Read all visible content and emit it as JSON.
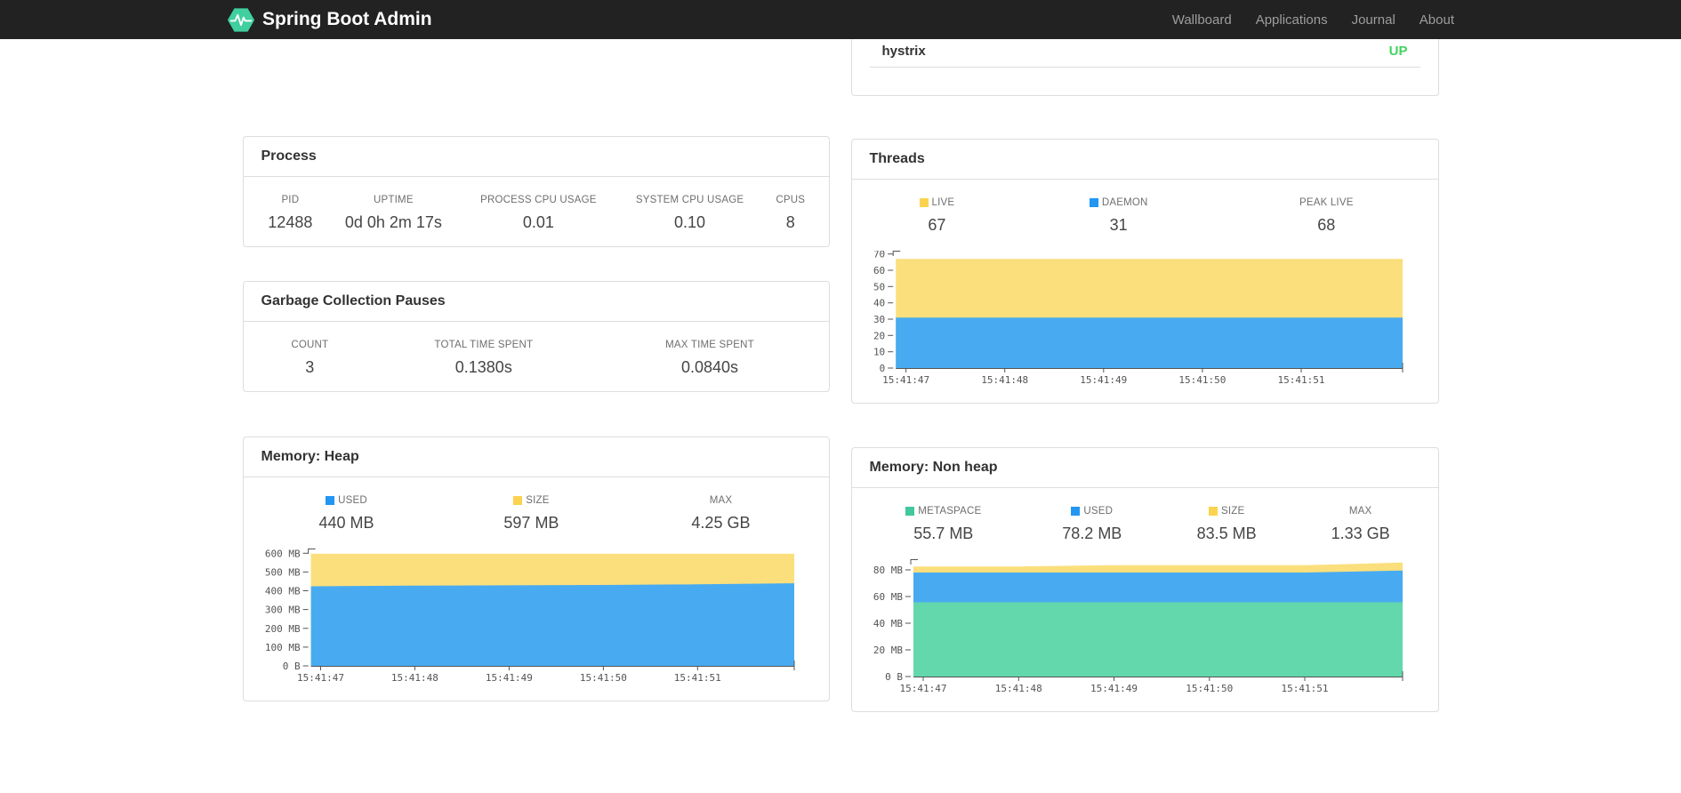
{
  "navbar": {
    "brand": "Spring Boot Admin",
    "links": [
      {
        "label": "Wallboard"
      },
      {
        "label": "Applications"
      },
      {
        "label": "Journal"
      },
      {
        "label": "About"
      }
    ]
  },
  "colors": {
    "brand_green": "#40cf9f",
    "status_up": "#42d35f",
    "area_yellow": "#fbdf7c",
    "area_blue": "#48abf1",
    "area_green": "#62d8ac",
    "swatch_yellow": "#fcd34f",
    "swatch_blue": "#2196f3",
    "swatch_green": "#43c79e"
  },
  "status_card": {
    "service_name": "hystrix",
    "status": "UP"
  },
  "cards": {
    "process": {
      "title": "Process",
      "stats": [
        {
          "label": "PID",
          "value": "12488"
        },
        {
          "label": "UPTIME",
          "value": "0d 0h 2m 17s"
        },
        {
          "label": "PROCESS CPU USAGE",
          "value": "0.01"
        },
        {
          "label": "SYSTEM CPU USAGE",
          "value": "0.10"
        },
        {
          "label": "CPUS",
          "value": "8"
        }
      ]
    },
    "gc": {
      "title": "Garbage Collection Pauses",
      "stats": [
        {
          "label": "COUNT",
          "value": "3"
        },
        {
          "label": "TOTAL TIME SPENT",
          "value": "0.1380s"
        },
        {
          "label": "MAX TIME SPENT",
          "value": "0.0840s"
        }
      ]
    },
    "threads": {
      "title": "Threads",
      "stats": [
        {
          "label": "LIVE",
          "value": "67",
          "swatch": "#fcd34f"
        },
        {
          "label": "DAEMON",
          "value": "31",
          "swatch": "#2196f3"
        },
        {
          "label": "PEAK LIVE",
          "value": "68"
        }
      ]
    },
    "heap": {
      "title": "Memory: Heap",
      "stats": [
        {
          "label": "USED",
          "value": "440 MB",
          "swatch": "#2196f3"
        },
        {
          "label": "SIZE",
          "value": "597 MB",
          "swatch": "#fcd34f"
        },
        {
          "label": "MAX",
          "value": "4.25 GB"
        }
      ]
    },
    "nonheap": {
      "title": "Memory: Non heap",
      "stats": [
        {
          "label": "METASPACE",
          "value": "55.7 MB",
          "swatch": "#43c79e"
        },
        {
          "label": "USED",
          "value": "78.2 MB",
          "swatch": "#2196f3"
        },
        {
          "label": "SIZE",
          "value": "83.5 MB",
          "swatch": "#fcd34f"
        },
        {
          "label": "MAX",
          "value": "1.33 GB"
        }
      ]
    }
  },
  "chart_data": [
    {
      "id": "threads",
      "type": "area",
      "title": "Threads",
      "x": [
        "15:41:47",
        "15:41:48",
        "15:41:49",
        "15:41:50",
        "15:41:51"
      ],
      "ylim": [
        0,
        72
      ],
      "yticks": [
        {
          "v": 0,
          "label": "0"
        },
        {
          "v": 10,
          "label": "10"
        },
        {
          "v": 20,
          "label": "20"
        },
        {
          "v": 30,
          "label": "30"
        },
        {
          "v": 40,
          "label": "40"
        },
        {
          "v": 50,
          "label": "50"
        },
        {
          "v": 60,
          "label": "60"
        },
        {
          "v": 70,
          "label": "70"
        }
      ],
      "series": [
        {
          "name": "live",
          "color": "#fbdf7c",
          "values": [
            67,
            67,
            67,
            67,
            67,
            67
          ]
        },
        {
          "name": "daemon",
          "color": "#48abf1",
          "values": [
            31,
            31,
            31,
            31,
            31,
            31
          ]
        }
      ]
    },
    {
      "id": "heap",
      "type": "area",
      "title": "Memory: Heap",
      "x": [
        "15:41:47",
        "15:41:48",
        "15:41:49",
        "15:41:50",
        "15:41:51"
      ],
      "ylim": [
        0,
        625
      ],
      "yticks": [
        {
          "v": 0,
          "label": "0 B"
        },
        {
          "v": 100,
          "label": "100 MB"
        },
        {
          "v": 200,
          "label": "200 MB"
        },
        {
          "v": 300,
          "label": "300 MB"
        },
        {
          "v": 400,
          "label": "400 MB"
        },
        {
          "v": 500,
          "label": "500 MB"
        },
        {
          "v": 600,
          "label": "600 MB"
        }
      ],
      "series": [
        {
          "name": "size",
          "color": "#fbdf7c",
          "values": [
            597,
            597,
            597,
            597,
            597,
            597
          ]
        },
        {
          "name": "used",
          "color": "#48abf1",
          "values": [
            424,
            427,
            429,
            431,
            434,
            440
          ]
        }
      ]
    },
    {
      "id": "nonheap",
      "type": "area",
      "title": "Memory: Non heap",
      "x": [
        "15:41:47",
        "15:41:48",
        "15:41:49",
        "15:41:50",
        "15:41:51"
      ],
      "ylim": [
        0,
        88
      ],
      "yticks": [
        {
          "v": 0,
          "label": "0 B"
        },
        {
          "v": 20,
          "label": "20 MB"
        },
        {
          "v": 40,
          "label": "40 MB"
        },
        {
          "v": 60,
          "label": "60 MB"
        },
        {
          "v": 80,
          "label": "80 MB"
        }
      ],
      "series": [
        {
          "name": "size",
          "color": "#fbdf7c",
          "values": [
            82.5,
            82.5,
            83.5,
            83.5,
            83.5,
            85.5
          ]
        },
        {
          "name": "used",
          "color": "#48abf1",
          "values": [
            78,
            78,
            78,
            78,
            78,
            79.5
          ]
        },
        {
          "name": "metaspace",
          "color": "#62d8ac",
          "values": [
            55.7,
            55.7,
            55.7,
            55.7,
            55.7,
            55.7
          ]
        }
      ]
    }
  ]
}
